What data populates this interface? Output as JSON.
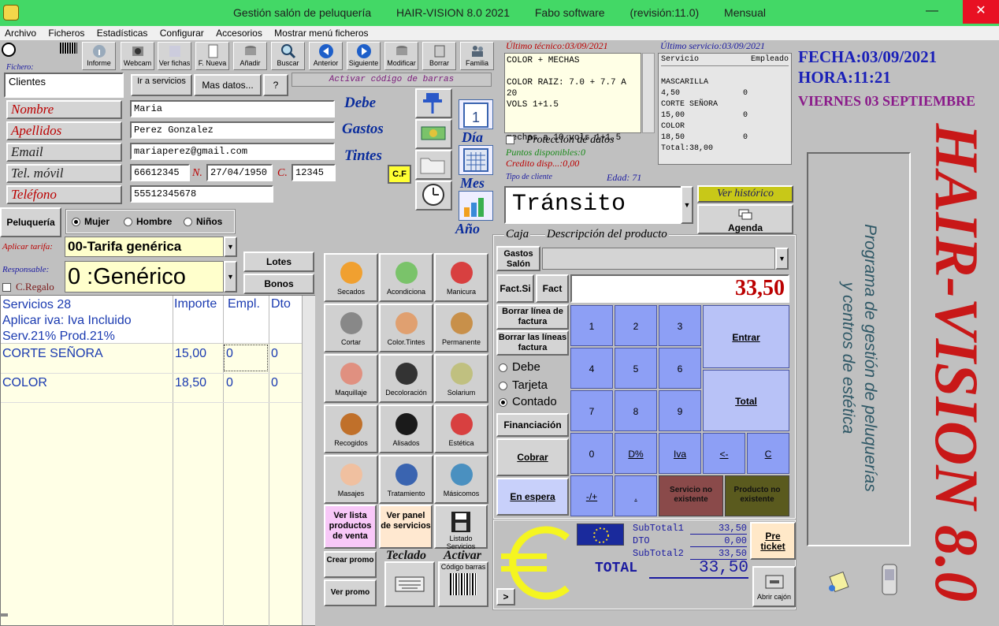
{
  "window": {
    "app_name": "Gestión salón de peluquería",
    "version": "HAIR-VISION 8.0 2021",
    "company": "Fabo software",
    "revision": "(revisión:11.0)",
    "plan": "Mensual",
    "minimize": "—",
    "maximize": "☐",
    "close": "✕"
  },
  "menu": [
    "Archivo",
    "Ficheros",
    "Estadísticas",
    "Configurar",
    "Accesorios",
    "Mostrar menú ficheros"
  ],
  "toolbar": [
    "Informe",
    "Webcam",
    "Ver fichas",
    "F. Nueva",
    "Añadir",
    "Buscar",
    "Anterior",
    "Siguiente",
    "Modificar",
    "Borrar",
    "Familia"
  ],
  "fichero": {
    "label": "Fichero:",
    "value": "Clientes",
    "ir_a_servicios": "Ir a servicios",
    "mas_datos": "Mas datos...",
    "help": "?",
    "barcode_activate": "Activar código de barras"
  },
  "client": {
    "nombre_label": "Nombre",
    "nombre": "Maria",
    "apellidos_label": "Apellidos",
    "apellidos": "Perez Gonzalez",
    "email_label": "Email",
    "email": "mariaperez@gmail.com",
    "movil_label": "Tel. móvil",
    "movil": "66612345",
    "n_label": "N.",
    "nacimiento": "27/04/1950",
    "c_label": "C.",
    "codigo": "12345",
    "telefono_label": "Teléfono",
    "telefono": "55512345678"
  },
  "summary": {
    "debe": "Debe",
    "gastos": "Gastos",
    "tintes": "Tintes",
    "cf": "C.F"
  },
  "period": {
    "dia": "Día",
    "mes": "Mes",
    "anio": "Año"
  },
  "ultimo_tecnico": {
    "label": "Último técnico:03/09/2021",
    "lines": [
      "COLOR + MECHAS",
      "",
      "COLOR RAIZ: 7.0 + 7.7 A 20",
      "VOLS 1+1.5",
      "",
      "",
      "mechas a 10 vols 1+1.5"
    ]
  },
  "ultimo_servicio": {
    "label": "Último servicio:03/09/2021",
    "col_servicio": "Servicio",
    "col_empleado": "Empleado",
    "rows": [
      {
        "name": "MASCARILLA",
        "price": "4,50",
        "emp": "0"
      },
      {
        "name": "CORTE SEÑORA",
        "price": "15,00",
        "emp": "0"
      },
      {
        "name": "COLOR",
        "price": "18,50",
        "emp": "0"
      }
    ],
    "total": "Total:38,00"
  },
  "datetime": {
    "fecha": "FECHA:03/09/2021",
    "hora": "HORA:11:21",
    "dia": "VIERNES 03 SEPTIEMBRE"
  },
  "proteccion": "Protección de datos",
  "puntos": "Puntos disponibles:0",
  "credito": "Credito disp...:0,00",
  "tipo_cliente_label": "Tipo de cliente",
  "edad": "Edad: 71",
  "tipo_cliente": "Tránsito",
  "ver_historico": "Ver histórico",
  "agenda": "Agenda",
  "peluqueria": "Peluquería",
  "gender": {
    "mujer": "Mujer",
    "hombre": "Hombre",
    "ninos": "Niños"
  },
  "tarifa": {
    "label": "Aplicar tarifa:",
    "value": "00-Tarifa genérica"
  },
  "responsable": {
    "label": "Responsable:",
    "value": "0 :Genérico"
  },
  "cregalo": "C.Regalo",
  "lotes": "Lotes",
  "bonos": "Bonos",
  "services": {
    "header_line1": "Servicios    28",
    "header_line2": "Aplicar iva: Iva Incluido",
    "header_line3": "Serv.21%    Prod.21%",
    "col_importe": "Importe",
    "col_empl": "Empl.",
    "col_dto": "Dto",
    "rows": [
      {
        "name": "CORTE SEÑORA",
        "importe": "15,00",
        "empl": "0",
        "dto": "0"
      },
      {
        "name": "COLOR",
        "importe": "18,50",
        "empl": "0",
        "dto": "0"
      }
    ]
  },
  "categories": [
    "Secados",
    "Acondiciona",
    "Manicura",
    "Cortar",
    "Color.Tintes",
    "Permanente",
    "Maquillaje",
    "Decoloración",
    "Solarium",
    "Recogidos",
    "Alisados",
    "Estética",
    "Masajes",
    "Tratamiento",
    "Másicomos"
  ],
  "bottom_buttons": {
    "ver_lista": "Ver lista productos de venta",
    "ver_panel": "Ver panel de servicios",
    "listado": "Listado Servicios",
    "crear_promo": "Crear promo",
    "ver_promo": "Ver promo",
    "teclado": "Teclado",
    "activar": "Activar",
    "codigo_barras": "Código barras"
  },
  "caja": {
    "caja_label": "Caja",
    "descripcion_label": "Descripción del producto",
    "gastos_salon": "Gastos Salón",
    "fact_si": "Fact.Si",
    "fact": "Fact",
    "amount": "33,50",
    "borrar_linea": "Borrar línea de factura",
    "borrar_lineas": "Borrar las líneas factura",
    "debe": "Debe",
    "tarjeta": "Tarjeta",
    "contado": "Contado",
    "financiacion": "Financiación",
    "cobrar": "Cobrar",
    "en_espera": "En espera",
    "keys": [
      "1",
      "2",
      "3",
      "4",
      "5",
      "6",
      "7",
      "8",
      "9",
      "0",
      "D%",
      "Iva",
      "<-",
      "C",
      "-/+",
      "."
    ],
    "entrar": "Entrar",
    "total_key": "Total",
    "servicio_no": "Servicio no existente",
    "producto_no": "Producto no existente"
  },
  "totals": {
    "subtotal1_label": "SubTotal1",
    "subtotal1": "33,50",
    "dto_label": "DTO",
    "dto": "0,00",
    "subtotal2_label": "SubTotal2",
    "subtotal2": "33,50",
    "total_label": "TOTAL",
    "total": "33,50",
    "pre_ticket": "Pre ticket",
    "abrir_cajon": "Abrir cajón",
    "arrow": ">"
  },
  "branding": {
    "logo": "HAIR-VISION 8.0",
    "tagline1": "Programa de gestión de peluquerías",
    "tagline2": "y centros de estética"
  },
  "colors": {
    "titlebar": "#43d866",
    "accent_blue": "#0a2c9c",
    "label_red": "#b00000",
    "keypad": "#8d9ff5",
    "logo_red": "#c81818"
  }
}
